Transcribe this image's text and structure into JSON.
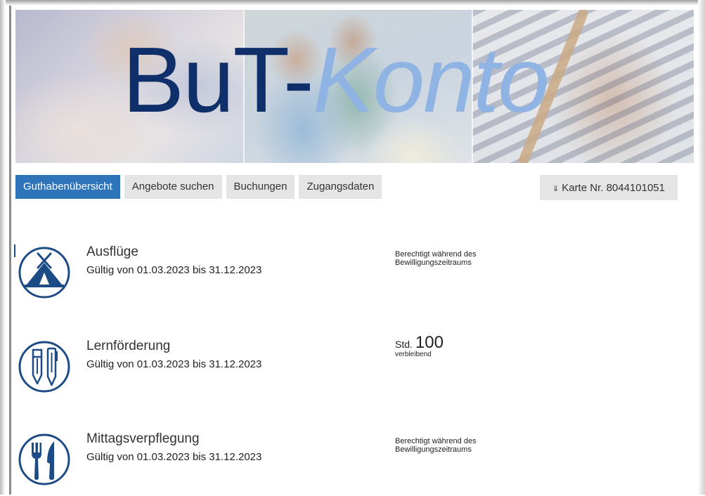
{
  "banner": {
    "title_part1": "BuT-",
    "title_part2": "Konto"
  },
  "nav": {
    "tabs": [
      {
        "label": "Guthabenübersicht",
        "active": true
      },
      {
        "label": "Angebote suchen",
        "active": false
      },
      {
        "label": "Buchungen",
        "active": false
      },
      {
        "label": "Zugangsdaten",
        "active": false
      }
    ],
    "card_button": {
      "icon": "arrow-down-icon",
      "arrow_glyph": "⇓",
      "label": "Karte Nr. 8044101051"
    }
  },
  "items": [
    {
      "icon": "tent-icon",
      "title": "Ausflüge",
      "validity": "Gültig von 01.03.2023 bis 31.12.2023",
      "status_line1": "Berechtigt während des",
      "status_line2": "Bewilligungszeitraums"
    },
    {
      "icon": "pencil-pen-icon",
      "title": "Lernförderung",
      "validity": "Gültig von 01.03.2023 bis 31.12.2023",
      "hours_label": "Std.",
      "hours_value": "100",
      "hours_sub": "verbleibend"
    },
    {
      "icon": "fork-knife-icon",
      "title": "Mittagsverpflegung",
      "validity": "Gültig von 01.03.2023 bis 31.12.2023",
      "status_line1": "Berechtigt während des",
      "status_line2": "Bewilligungszeitraums"
    }
  ],
  "colors": {
    "brand_dark": "#0e2f6a",
    "brand_light": "#8fb3e3",
    "tab_active": "#2d74bb",
    "icon_blue": "#1d4b86"
  }
}
